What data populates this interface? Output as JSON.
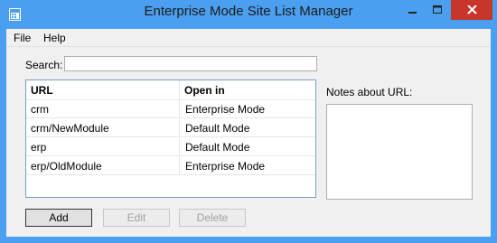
{
  "window": {
    "title": "Enterprise Mode Site List Manager",
    "accent_color": "#4a9ff0",
    "close_color": "#c7352b"
  },
  "menu": {
    "items": [
      {
        "label": "File"
      },
      {
        "label": "Help"
      }
    ]
  },
  "search": {
    "label": "Search:",
    "value": ""
  },
  "site_list": {
    "columns": [
      "URL",
      "Open in"
    ],
    "rows": [
      {
        "url": "crm",
        "mode": "Enterprise Mode"
      },
      {
        "url": "crm/NewModule",
        "mode": "Default Mode"
      },
      {
        "url": "erp",
        "mode": "Default Mode"
      },
      {
        "url": "erp/OldModule",
        "mode": "Enterprise Mode"
      }
    ]
  },
  "notes": {
    "label": "Notes about URL:",
    "value": ""
  },
  "actions": {
    "add_label": "Add",
    "edit_label": "Edit",
    "delete_label": "Delete"
  }
}
